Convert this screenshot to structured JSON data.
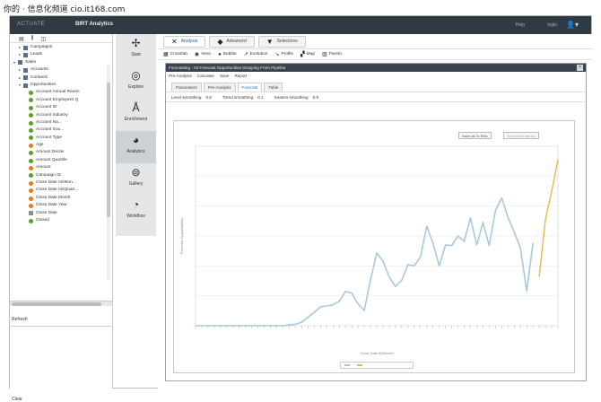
{
  "watermark": "你的 · 信息化频道 cio.it168.com",
  "app": {
    "vendor_logo": "ACTUATE",
    "title": "BIRT Analytics",
    "help_label": "Help",
    "login_label": "login"
  },
  "tree": {
    "items": [
      {
        "label": "Campaigns",
        "level": 1,
        "arrow": "▸",
        "icon": "table"
      },
      {
        "label": "Leads",
        "level": 1,
        "arrow": "▸",
        "icon": "table"
      },
      {
        "label": "Sales",
        "level": 0,
        "arrow": "▾",
        "icon": "table"
      },
      {
        "label": "Accounts",
        "level": 1,
        "arrow": "▸",
        "icon": "table"
      },
      {
        "label": "Contacts",
        "level": 1,
        "arrow": "▸",
        "icon": "table"
      },
      {
        "label": "Opportunities",
        "level": 1,
        "arrow": "▾",
        "icon": "table"
      },
      {
        "label": "Account Annual Reven",
        "level": 2,
        "arrow": "",
        "icon": "green"
      },
      {
        "label": "Account Employees Q",
        "level": 2,
        "arrow": "",
        "icon": "green"
      },
      {
        "label": "Account ID",
        "level": 2,
        "arrow": "",
        "icon": "green"
      },
      {
        "label": "Account Industry",
        "level": 2,
        "arrow": "",
        "icon": "green"
      },
      {
        "label": "Account Na...",
        "level": 2,
        "arrow": "",
        "icon": "green"
      },
      {
        "label": "Account Sou...",
        "level": 2,
        "arrow": "",
        "icon": "green"
      },
      {
        "label": "Account Type",
        "level": 2,
        "arrow": "",
        "icon": "green"
      },
      {
        "label": "Age",
        "level": 2,
        "arrow": "",
        "icon": "orange"
      },
      {
        "label": "Amount Decile",
        "level": 2,
        "arrow": "",
        "icon": "green"
      },
      {
        "label": "Amount Quartile",
        "level": 2,
        "arrow": "",
        "icon": "green"
      },
      {
        "label": "Amount",
        "level": 2,
        "arrow": "",
        "icon": "orange"
      },
      {
        "label": "Campaign ID",
        "level": 2,
        "arrow": "",
        "icon": "green"
      },
      {
        "label": "Close Date ADMon...",
        "level": 2,
        "arrow": "",
        "icon": "orange"
      },
      {
        "label": "Close Date ADQuart...",
        "level": 2,
        "arrow": "",
        "icon": "orange"
      },
      {
        "label": "Close Date Month",
        "level": 2,
        "arrow": "",
        "icon": "orange"
      },
      {
        "label": "Close Date Year",
        "level": 2,
        "arrow": "",
        "icon": "orange"
      },
      {
        "label": "Close Date",
        "level": 2,
        "arrow": "",
        "icon": "cal"
      },
      {
        "label": "Closed",
        "level": 2,
        "arrow": "",
        "icon": "green"
      }
    ],
    "refresh_label": "Refresh",
    "clear_label": "Clear"
  },
  "nav": [
    {
      "label": "Start",
      "icon": "✢",
      "name": "start"
    },
    {
      "label": "Explore",
      "icon": "◎",
      "name": "explore"
    },
    {
      "label": "Enrichment",
      "icon": "Å",
      "name": "enrichment"
    },
    {
      "label": "Analytics",
      "icon": "◕",
      "name": "analytics"
    },
    {
      "label": "Gallery",
      "icon": "⊜",
      "name": "gallery"
    },
    {
      "label": "Workflow",
      "icon": "◔",
      "name": "workflow"
    }
  ],
  "tabs": [
    {
      "label": "Analysis",
      "icon": "✕"
    },
    {
      "label": "Advanced",
      "icon": "◆"
    },
    {
      "label": "Selections",
      "icon": "▼"
    }
  ],
  "toolbar": [
    "Crosstab",
    "Venn",
    "Bubble",
    "Evolution",
    "Profile",
    "Map",
    "Pareto"
  ],
  "dialog": {
    "title": "Forecasting - 04 Forecast Opportunities Dropping From Pipeline",
    "close": "×",
    "menu": [
      "Pre-Analysis",
      "Calculate",
      "Save",
      "Report"
    ],
    "tabs": [
      "Parameters",
      "Pre-Analysis",
      "Forecast",
      "Table"
    ],
    "active_tab": 2,
    "params": [
      {
        "label": "Level smoothing",
        "value": "0.8"
      },
      {
        "label": "Trend smoothing",
        "value": "0.1"
      },
      {
        "label": "Season smoothing",
        "value": "0.9"
      }
    ],
    "chart_buttons": [
      "Save as To Risk",
      "Show/hide tabular"
    ]
  },
  "chart_data": {
    "type": "line",
    "xlabel": "Close Date ADMonth",
    "ylabel": "Forecast Opportunities",
    "series": [
      {
        "color": "#a8c8df",
        "x": [
          1,
          2,
          3,
          4,
          5,
          6,
          7,
          8,
          9,
          10,
          11,
          12,
          13,
          14,
          15,
          16,
          17,
          18,
          19,
          20,
          21,
          22,
          23,
          24,
          25,
          26,
          27,
          28,
          29,
          30,
          31,
          32,
          33,
          34,
          35,
          36,
          37,
          38,
          39,
          40,
          41,
          42,
          43,
          44,
          45,
          46,
          47,
          48,
          49,
          50,
          51,
          52,
          53,
          54,
          55
        ],
        "values": [
          0,
          0,
          0,
          0,
          0,
          0,
          0,
          0,
          0,
          0,
          0,
          0,
          0,
          0,
          0,
          0.3,
          0.5,
          1.2,
          2.8,
          4.5,
          6.3,
          6.6,
          7.0,
          8.2,
          11.5,
          10.9,
          7.3,
          5.1,
          15.3,
          24.3,
          21.6,
          16.3,
          13.1,
          15.2,
          20.4,
          20.0,
          23.0,
          33.3,
          27.6,
          20.0,
          27.0,
          26.8,
          30.0,
          28.2,
          36.0,
          27.0,
          34.5,
          26.8,
          38.5,
          42.7,
          36.3,
          31.3,
          26.0,
          11.6,
          27.5
        ]
      },
      {
        "color": "#e8b84a",
        "x": [
          56,
          57,
          58,
          59
        ],
        "values": [
          16.5,
          35.5,
          45.0,
          55.5
        ]
      }
    ]
  }
}
